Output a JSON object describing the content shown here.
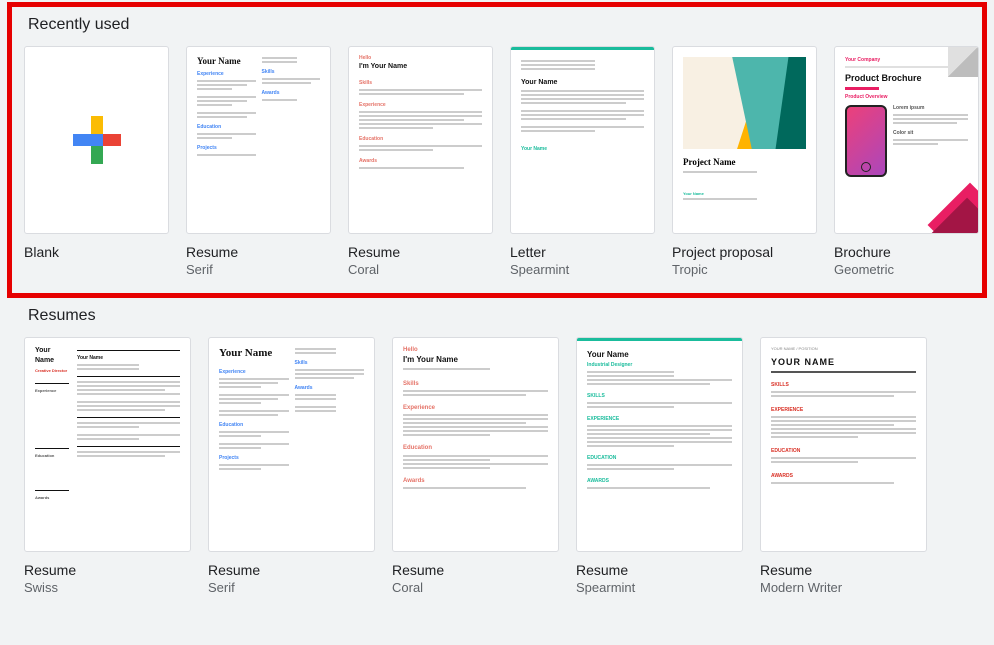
{
  "sections": {
    "recent": {
      "title": "Recently used"
    },
    "resumes": {
      "title": "Resumes"
    }
  },
  "recent_templates": [
    {
      "title": "Blank",
      "subtitle": ""
    },
    {
      "title": "Resume",
      "subtitle": "Serif"
    },
    {
      "title": "Resume",
      "subtitle": "Coral"
    },
    {
      "title": "Letter",
      "subtitle": "Spearmint"
    },
    {
      "title": "Project proposal",
      "subtitle": "Tropic"
    },
    {
      "title": "Brochure",
      "subtitle": "Geometric"
    }
  ],
  "resume_templates": [
    {
      "title": "Resume",
      "subtitle": "Swiss"
    },
    {
      "title": "Resume",
      "subtitle": "Serif"
    },
    {
      "title": "Resume",
      "subtitle": "Coral"
    },
    {
      "title": "Resume",
      "subtitle": "Spearmint"
    },
    {
      "title": "Resume",
      "subtitle": "Modern Writer"
    }
  ],
  "thumb_text": {
    "your_name": "Your Name",
    "your_company": "Your Company",
    "product_brochure": "Product Brochure",
    "product_overview": "Product Overview",
    "project_name": "Project Name",
    "hello": "Hello",
    "im_your_name": "I'm Your Name",
    "skills": "Skills",
    "experience": "Experience",
    "education": "Education",
    "projects": "Projects",
    "awards": "Awards",
    "creative_director": "Creative Director",
    "industrial_designer": "Industrial Designer",
    "lorem": "Lorem ipsum",
    "color_sit": "Color sit",
    "skills_up": "SKILLS"
  }
}
